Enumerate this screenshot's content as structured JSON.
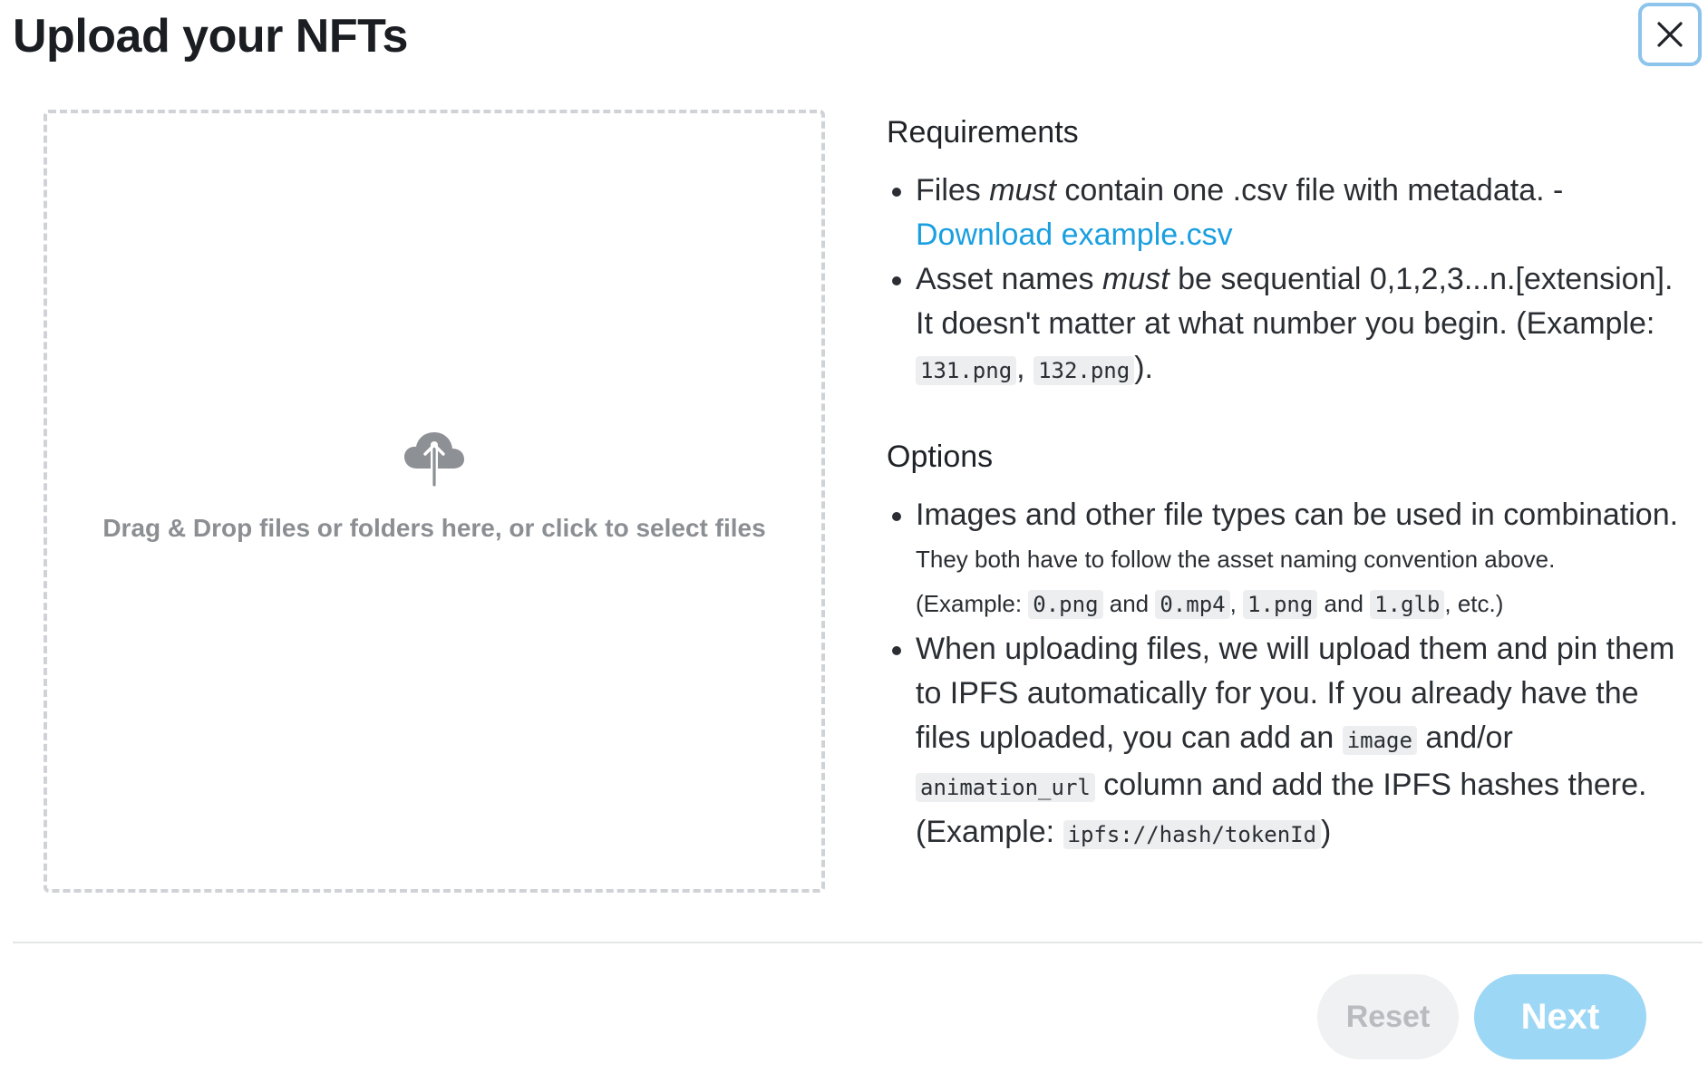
{
  "modal": {
    "title": "Upload your NFTs"
  },
  "dropzone": {
    "text": "Drag & Drop files or folders here, or click to select files",
    "icon": "cloud-upload-icon"
  },
  "requirements": {
    "title": "Requirements",
    "item1": {
      "pre": "Files ",
      "emphasis": "must",
      "post": " contain one .csv file with metadata. - ",
      "link": "Download example.csv"
    },
    "item2": {
      "pre": "Asset names ",
      "emphasis": "must",
      "post": " be sequential 0,1,2,3...n.[extension]. It doesn't matter at what number you begin. (Example: ",
      "code1": "131.png",
      "sep": ", ",
      "code2": "132.png",
      "end": ")."
    }
  },
  "options": {
    "title": "Options",
    "item1": {
      "text": "Images and other file types can be used in combination.",
      "note1": "They both have to follow the asset naming convention above.",
      "note2_pre": "(Example: ",
      "code1": "0.png",
      "and1": " and ",
      "code2": "0.mp4",
      "sep": ", ",
      "code3": "1.png",
      "and2": " and ",
      "code4": "1.glb",
      "note2_end": ", etc.)"
    },
    "item2": {
      "pre": "When uploading files, we will upload them and pin them to IPFS automatically for you. If you already have the files uploaded, you can add an ",
      "code1": "image",
      "mid1": " and/or ",
      "code2": "animation_url",
      "mid2": " column and add the IPFS hashes there. (Example: ",
      "code3": "ipfs://hash/tokenId",
      "end": ")"
    }
  },
  "footer": {
    "reset_label": "Reset",
    "next_label": "Next"
  },
  "colors": {
    "link": "#1a9fe0",
    "next_button": "#9cd7f5",
    "close_focus_ring": "#8cc4ec"
  }
}
